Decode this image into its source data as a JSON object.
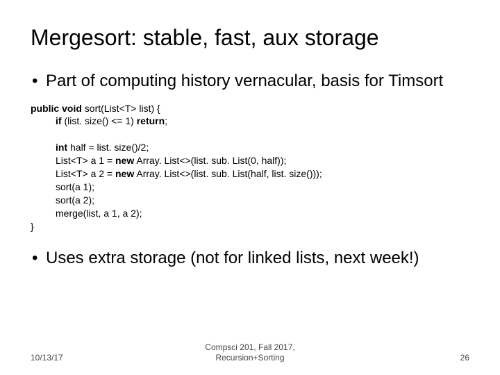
{
  "title": "Mergesort: stable, fast, aux storage",
  "bullets": {
    "b1": "Part of computing history vernacular, basis for Timsort",
    "b2": "Uses extra storage (not for linked lists, next week!)"
  },
  "code": {
    "l1a": "public void",
    "l1b": " sort(List<T> list) {",
    "l2a": "if",
    "l2b": " (list. size() <= 1) ",
    "l2c": "return",
    "l2d": ";",
    "l3a": "int",
    "l3b": " half = list. size()/2;",
    "l4a": "List<T> a 1 = ",
    "l4b": "new",
    "l4c": " Array. List<>(list. sub. List(0, half));",
    "l5a": "List<T> a 2 = ",
    "l5b": "new",
    "l5c": " Array. List<>(list. sub. List(half, list. size()));",
    "l6": "sort(a 1);",
    "l7": "sort(a 2);",
    "l8": "merge(list, a 1, a 2);",
    "l9": "}"
  },
  "footer": {
    "left": "10/13/17",
    "center_line1": "Compsci 201, Fall 2017,",
    "center_line2": "Recursion+Sorting",
    "right": "26"
  }
}
